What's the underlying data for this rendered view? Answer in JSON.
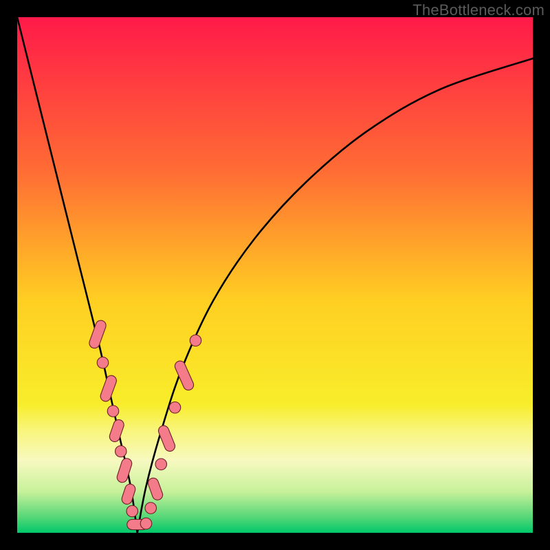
{
  "watermark": "TheBottleneck.com",
  "gradient_stops": [
    {
      "offset": 0,
      "color": "#ff1a49"
    },
    {
      "offset": 0.3,
      "color": "#ff6d34"
    },
    {
      "offset": 0.55,
      "color": "#ffcf22"
    },
    {
      "offset": 0.75,
      "color": "#f8ed2a"
    },
    {
      "offset": 0.8,
      "color": "#f8f57a"
    },
    {
      "offset": 0.86,
      "color": "#f7f9c0"
    },
    {
      "offset": 0.92,
      "color": "#c7f19a"
    },
    {
      "offset": 0.97,
      "color": "#55d777"
    },
    {
      "offset": 1.0,
      "color": "#00c86a"
    }
  ],
  "marker_color": "#f47b8a",
  "marker_stroke": "#6a1f26",
  "curve_color": "#000000",
  "chart_data": {
    "type": "line",
    "title": "",
    "xlabel": "",
    "ylabel": "",
    "xlim": [
      0,
      100
    ],
    "ylim": [
      0,
      100
    ],
    "series": [
      {
        "name": "bottleneck-curve",
        "x": [
          0,
          4,
          8,
          12,
          16,
          18,
          20,
          22,
          23.3,
          25,
          28,
          32,
          38,
          46,
          56,
          68,
          82,
          100
        ],
        "y": [
          100,
          84,
          68,
          52,
          36,
          27,
          18,
          9,
          0,
          9,
          20,
          32,
          45,
          57,
          68,
          78,
          86,
          92
        ]
      }
    ],
    "markers": [
      {
        "shape": "roundrect",
        "cx": 15.6,
        "cy": 38.5,
        "rx": 1.0,
        "ry": 2.8,
        "rot": 20
      },
      {
        "shape": "circle",
        "cx": 16.6,
        "cy": 33.0,
        "r": 1.1
      },
      {
        "shape": "roundrect",
        "cx": 17.7,
        "cy": 28.0,
        "rx": 1.0,
        "ry": 2.6,
        "rot": 20
      },
      {
        "shape": "circle",
        "cx": 18.6,
        "cy": 23.6,
        "r": 1.1
      },
      {
        "shape": "roundrect",
        "cx": 19.3,
        "cy": 19.8,
        "rx": 1.0,
        "ry": 2.2,
        "rot": 19
      },
      {
        "shape": "circle",
        "cx": 20.1,
        "cy": 15.8,
        "r": 1.1
      },
      {
        "shape": "roundrect",
        "cx": 20.8,
        "cy": 12.1,
        "rx": 1.0,
        "ry": 2.4,
        "rot": 18
      },
      {
        "shape": "roundrect",
        "cx": 21.6,
        "cy": 7.5,
        "rx": 1.0,
        "ry": 2.0,
        "rot": 18
      },
      {
        "shape": "circle",
        "cx": 22.3,
        "cy": 4.2,
        "r": 1.1
      },
      {
        "shape": "roundrect",
        "cx": 23.3,
        "cy": 1.6,
        "rx": 2.0,
        "ry": 1.0,
        "rot": 0
      },
      {
        "shape": "circle",
        "cx": 25.0,
        "cy": 1.8,
        "r": 1.1
      },
      {
        "shape": "circle",
        "cx": 25.9,
        "cy": 4.8,
        "r": 1.1
      },
      {
        "shape": "roundrect",
        "cx": 26.8,
        "cy": 8.5,
        "rx": 1.0,
        "ry": 2.2,
        "rot": -20
      },
      {
        "shape": "circle",
        "cx": 27.9,
        "cy": 13.3,
        "r": 1.1
      },
      {
        "shape": "roundrect",
        "cx": 29.0,
        "cy": 18.3,
        "rx": 1.0,
        "ry": 2.6,
        "rot": -22
      },
      {
        "shape": "circle",
        "cx": 30.6,
        "cy": 24.3,
        "r": 1.1
      },
      {
        "shape": "roundrect",
        "cx": 32.4,
        "cy": 30.5,
        "rx": 1.0,
        "ry": 3.0,
        "rot": -24
      },
      {
        "shape": "circle",
        "cx": 34.6,
        "cy": 37.3,
        "r": 1.1
      }
    ]
  }
}
